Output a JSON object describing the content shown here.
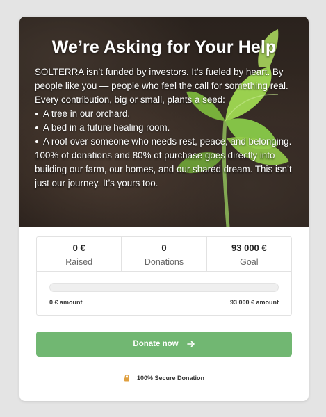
{
  "hero": {
    "title": "We’re Asking for Your Help",
    "intro": "SOLTERRA isn’t funded by investors. It’s fueled by heart. By people like you — people who feel the call for something real. Every contribution, big or small, plants a seed:",
    "bullets": [
      "A tree in our orchard.",
      "A bed in a future healing room.",
      "A roof over someone who needs rest, peace, and belonging."
    ],
    "closing": "100% of donations and 80% of purchase goes directly into building our farm, our homes, and our shared dream. This isn’t just our journey. It’s yours too."
  },
  "stats": {
    "raised": {
      "value": "0 €",
      "label": "Raised"
    },
    "donations": {
      "value": "0",
      "label": "Donations"
    },
    "goal": {
      "value": "93 000 €",
      "label": "Goal"
    }
  },
  "progress": {
    "fraction": 0,
    "min_label": "0 € amount",
    "max_label": "93 000 € amount"
  },
  "donate_button": {
    "label": "Donate now",
    "icon": "arrow-right-icon",
    "color": "#71b772"
  },
  "secure_note": {
    "label": "100% Secure Donation",
    "icon": "lock-icon",
    "icon_color": "#e0a040"
  }
}
